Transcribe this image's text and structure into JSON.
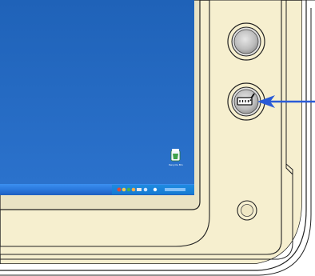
{
  "desktop": {
    "icons": [
      {
        "name": "Recycle Bin",
        "icon": "recycle-bin-icon"
      }
    ],
    "taskbar": {
      "tray_icons": [
        "network-icon",
        "volume-icon",
        "security-icon",
        "power-icon",
        "keyboard-icon",
        "pen-icon",
        "info-icon"
      ]
    }
  },
  "hardware": {
    "buttons": [
      {
        "name": "top-round-button"
      },
      {
        "name": "keyboard-pen-button",
        "icon": "keyboard-pen-icon"
      },
      {
        "name": "small-round-button"
      }
    ],
    "callout": {
      "target": "keyboard-pen-button",
      "color": "#2a5bd7"
    }
  },
  "colors": {
    "desktop_blue": "#1a5fb4",
    "taskbar_blue": "#2b7de0",
    "bezel": "#f6efcf",
    "outline": "#222222",
    "arrow": "#2a5bd7"
  }
}
